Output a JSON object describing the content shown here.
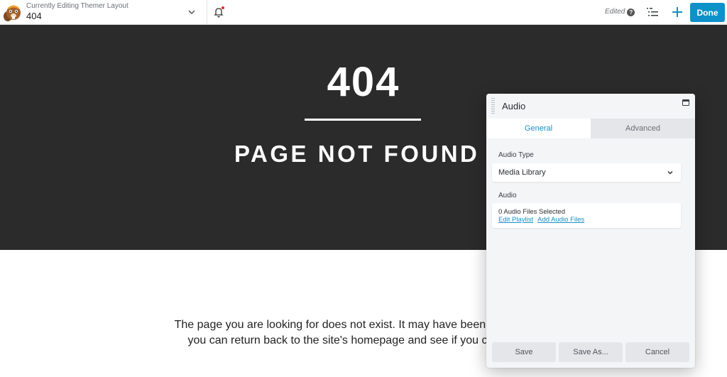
{
  "topbar": {
    "subtitle": "Currently Editing Themer Layout",
    "title": "404",
    "status": "Edited",
    "help_glyph": "?",
    "done_label": "Done",
    "icons": [
      "beaver-logo-icon",
      "chevron-down-icon",
      "bell-icon",
      "help-icon",
      "outline-list-icon",
      "plus-icon"
    ],
    "notification_dot_color": "#e3262b",
    "accent_color": "#0e91c9"
  },
  "page": {
    "heading": "404",
    "subheading": "PAGE NOT FOUND",
    "body_lines": [
      "The page you are looking for does not exist. It may have been moved, or re",
      "you can return back to the site's homepage and see if you can find wh"
    ]
  },
  "panel": {
    "title": "Audio",
    "tabs": [
      {
        "label": "General",
        "active": true
      },
      {
        "label": "Advanced",
        "active": false
      }
    ],
    "audio_type_label": "Audio Type",
    "audio_type_value": "Media Library",
    "audio_label": "Audio",
    "audio_count": "0 Audio Files Selected",
    "edit_playlist": "Edit Playlist",
    "add_audio_files": "Add Audio Files",
    "buttons": {
      "save": "Save",
      "save_as": "Save As...",
      "cancel": "Cancel"
    }
  }
}
